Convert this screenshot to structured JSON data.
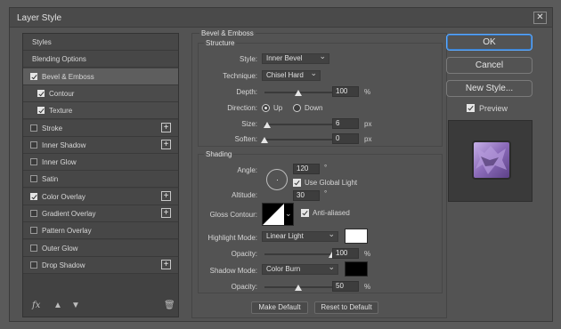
{
  "window": {
    "title": "Layer Style",
    "close_glyph": "✕"
  },
  "left_panel": {
    "items": [
      {
        "label": "Styles",
        "checkbox": false,
        "checked": false,
        "plus": false
      },
      {
        "label": "Blending Options",
        "checkbox": false,
        "checked": false,
        "plus": false
      },
      {
        "label": "Bevel & Emboss",
        "checkbox": true,
        "checked": true,
        "plus": false,
        "active": true
      },
      {
        "label": "Contour",
        "checkbox": true,
        "checked": true,
        "plus": false,
        "sub": true
      },
      {
        "label": "Texture",
        "checkbox": true,
        "checked": true,
        "plus": false,
        "sub": true
      },
      {
        "label": "Stroke",
        "checkbox": true,
        "checked": false,
        "plus": true
      },
      {
        "label": "Inner Shadow",
        "checkbox": true,
        "checked": false,
        "plus": true
      },
      {
        "label": "Inner Glow",
        "checkbox": true,
        "checked": false,
        "plus": false
      },
      {
        "label": "Satin",
        "checkbox": true,
        "checked": false,
        "plus": false
      },
      {
        "label": "Color Overlay",
        "checkbox": true,
        "checked": true,
        "plus": true
      },
      {
        "label": "Gradient Overlay",
        "checkbox": true,
        "checked": false,
        "plus": true
      },
      {
        "label": "Pattern Overlay",
        "checkbox": true,
        "checked": false,
        "plus": false
      },
      {
        "label": "Outer Glow",
        "checkbox": true,
        "checked": false,
        "plus": false
      },
      {
        "label": "Drop Shadow",
        "checkbox": true,
        "checked": false,
        "plus": true
      }
    ],
    "footer": {
      "fx_label": "fx"
    }
  },
  "bevel": {
    "section_title": "Bevel & Emboss",
    "structure_title": "Structure",
    "style_label": "Style:",
    "style_value": "Inner Bevel",
    "technique_label": "Technique:",
    "technique_value": "Chisel Hard",
    "depth_label": "Depth:",
    "depth_value": "100",
    "depth_unit": "%",
    "depth_level": 0.5,
    "direction_label": "Direction:",
    "direction_up": "Up",
    "direction_down": "Down",
    "direction_selected": "Up",
    "size_label": "Size:",
    "size_value": "6",
    "size_unit": "px",
    "size_level": 0.04,
    "soften_label": "Soften:",
    "soften_value": "0",
    "soften_unit": "px",
    "soften_level": 0.0
  },
  "shading": {
    "title": "Shading",
    "angle_label": "Angle:",
    "angle_value": "120",
    "angle_unit": "°",
    "global_light_label": "Use Global Light",
    "global_light": true,
    "altitude_label": "Altitude:",
    "altitude_value": "30",
    "altitude_unit": "°",
    "gloss_label": "Gloss Contour:",
    "anti_aliased_label": "Anti-aliased",
    "anti_aliased": true,
    "highlight_label": "Highlight Mode:",
    "highlight_mode": "Linear Light",
    "highlight_color": "#ffffff",
    "highlight_opacity_label": "Opacity:",
    "highlight_opacity": "100",
    "highlight_opacity_unit": "%",
    "highlight_level": 1.0,
    "shadow_label": "Shadow Mode:",
    "shadow_mode": "Color Burn",
    "shadow_color": "#000000",
    "shadow_opacity_label": "Opacity:",
    "shadow_opacity": "50",
    "shadow_opacity_unit": "%",
    "shadow_level": 0.5
  },
  "buttons": {
    "make_default": "Make Default",
    "reset_default": "Reset to Default",
    "ok": "OK",
    "cancel": "Cancel",
    "new_style": "New Style...",
    "preview_label": "Preview",
    "preview_checked": true
  },
  "colors": {
    "accent": "#5aa9ff",
    "preview_fill": "#9a7fc0"
  }
}
